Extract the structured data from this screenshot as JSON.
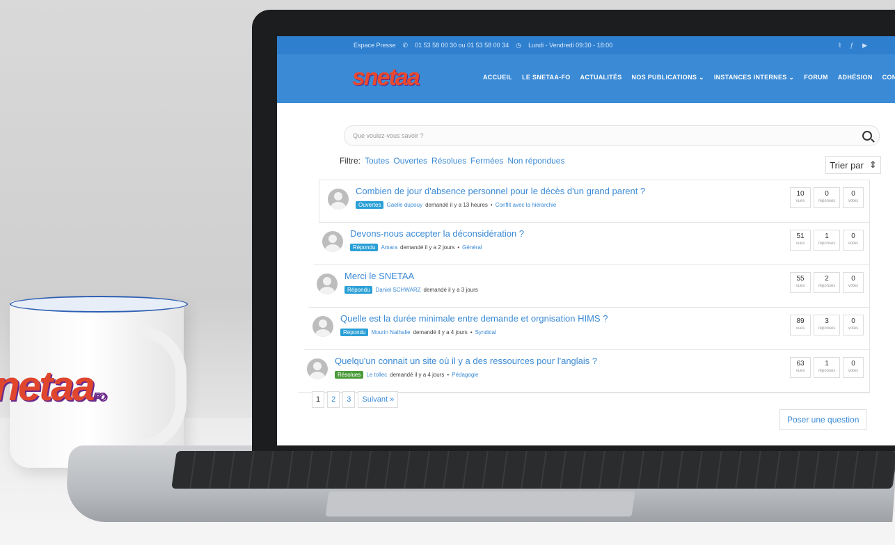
{
  "topbar": {
    "press": "Espace Presse",
    "phone": "01 53 58 00 30 ou 01 53 58 00 34",
    "hours": "Lundi - Vendredi 09:30 - 18:00"
  },
  "brand": {
    "logo": "snetaa"
  },
  "nav": {
    "items": [
      "ACCUEIL",
      "LE SNETAA-FO",
      "ACTUALITÉS",
      "NOS PUBLICATIONS ⌄",
      "INSTANCES INTERNES ⌄",
      "FORUM",
      "ADHÉSION",
      "CONTACTEZ-NOUS"
    ]
  },
  "search": {
    "placeholder": "Que voulez-vous savoir ?"
  },
  "filters": {
    "label": "Filtre:",
    "items": [
      "Toutes",
      "Ouvertes",
      "Résolues",
      "Fermées",
      "Non répondues"
    ]
  },
  "sort": {
    "label": "Trier par"
  },
  "questions": [
    {
      "title": "Combien de jour d'absence personnel pour le décès d'un grand parent ?",
      "status": "Ouvertes",
      "status_color": "#2a9fd6",
      "user": "Gaelle dupouy",
      "asked": "demandé il y a 13 heures",
      "sep": "•",
      "category": "Conflit avec la hiérarchie",
      "views": "10",
      "views_label": "vues",
      "answers": "0",
      "answers_label": "réponses",
      "votes": "0",
      "votes_label": "votes"
    },
    {
      "title": "Devons-nous accepter la déconsidération ?",
      "status": "Répondu",
      "status_color": "#2a9fd6",
      "user": "Amara",
      "asked": "demandé il y a 2 jours",
      "sep": "•",
      "category": "Général",
      "views": "51",
      "views_label": "vues",
      "answers": "1",
      "answers_label": "réponses",
      "votes": "0",
      "votes_label": "votes"
    },
    {
      "title": "Merci le SNETAA",
      "status": "Répondu",
      "status_color": "#2a9fd6",
      "user": "Daniel SCHWARZ",
      "asked": "demandé il y a 3 jours",
      "sep": "",
      "category": "",
      "views": "55",
      "views_label": "vues",
      "answers": "2",
      "answers_label": "réponses",
      "votes": "0",
      "votes_label": "votes"
    },
    {
      "title": "Quelle est la durée minimale entre demande et orgnisation HIMS ?",
      "status": "Répondu",
      "status_color": "#2a9fd6",
      "user": "Mourin Nathalie",
      "asked": "demandé il y a 4 jours",
      "sep": "•",
      "category": "Syndical",
      "views": "89",
      "views_label": "vues",
      "answers": "3",
      "answers_label": "réponses",
      "votes": "0",
      "votes_label": "votes"
    },
    {
      "title": "Quelqu'un connait un site où il y a des ressources pour l'anglais ?",
      "status": "Résolues",
      "status_color": "#4a9a3a",
      "user": "Le tollec",
      "asked": "demandé il y a 4 jours",
      "sep": "•",
      "category": "Pédagogie",
      "views": "63",
      "views_label": "vues",
      "answers": "1",
      "answers_label": "réponses",
      "votes": "0",
      "votes_label": "votes"
    }
  ],
  "pagination": {
    "pages": [
      "1",
      "2",
      "3"
    ],
    "next": "Suivant »"
  },
  "ask_button": "Poser une question",
  "mug": {
    "logo": "netaa",
    "sub": "FO"
  }
}
